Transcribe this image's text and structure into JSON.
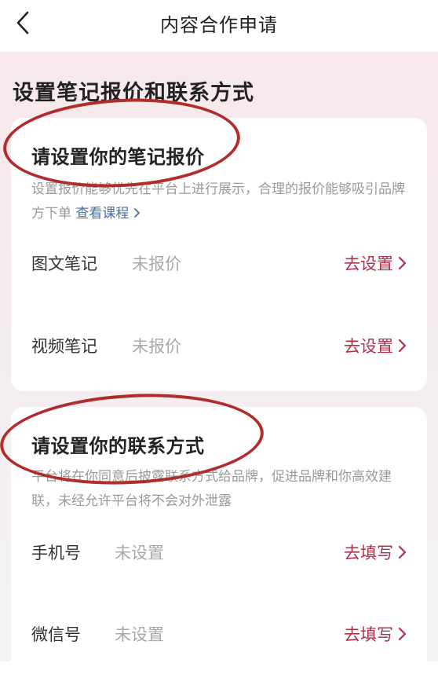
{
  "header": {
    "title": "内容合作申请"
  },
  "section_heading": "设置笔记报价和联系方式",
  "pricing_card": {
    "title": "请设置你的笔记报价",
    "description": "设置报价能够优先在平台上进行展示，合理的报价能够吸引品牌方下单",
    "course_link": "查看课程",
    "rows": [
      {
        "label": "图文笔记",
        "value": "未报价",
        "action": "去设置"
      },
      {
        "label": "视频笔记",
        "value": "未报价",
        "action": "去设置"
      }
    ]
  },
  "contact_card": {
    "title": "请设置你的联系方式",
    "description": "平台将在你同意后披露联系方式给品牌，促进品牌和你高效建联，未经允许平台将不会对外泄露",
    "rows": [
      {
        "label": "手机号",
        "value": "未设置",
        "action": "去填写"
      },
      {
        "label": "微信号",
        "value": "未设置",
        "action": "去填写"
      }
    ]
  },
  "colors": {
    "accent": "#b0304c",
    "link": "#4a6f9a",
    "annotation": "#b22c2c"
  }
}
